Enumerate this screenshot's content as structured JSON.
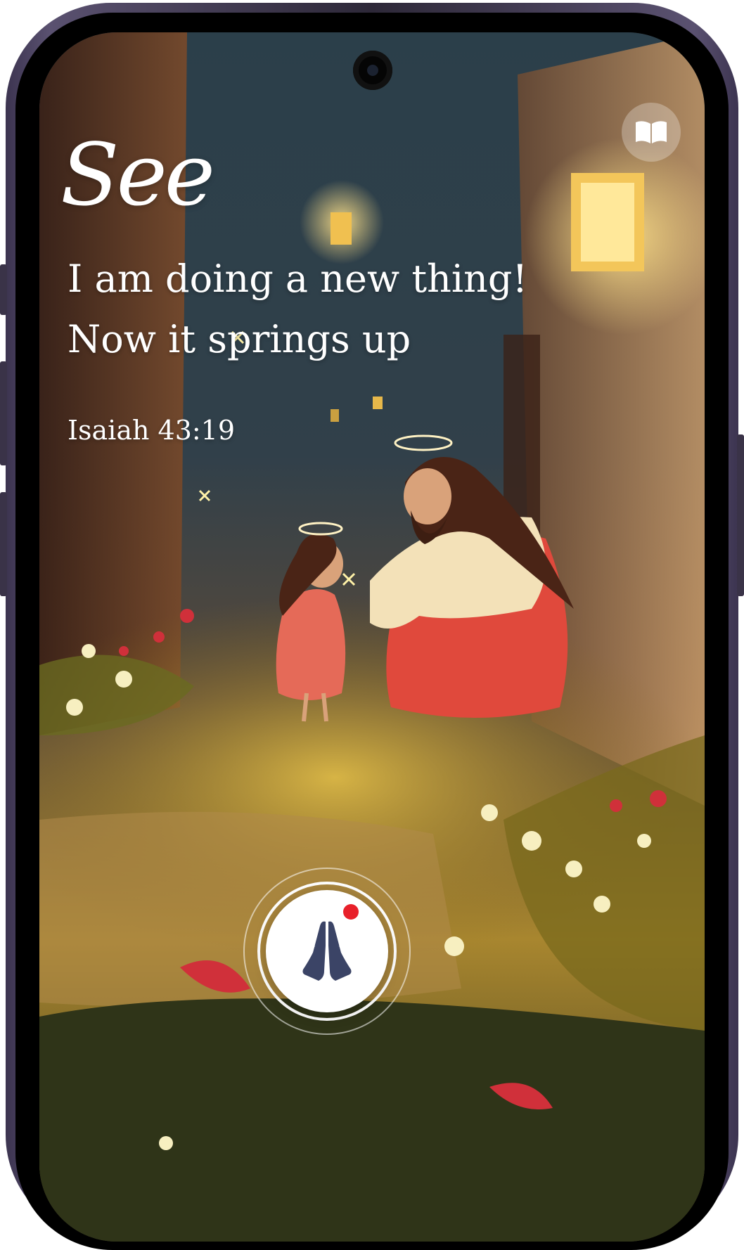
{
  "devotional": {
    "title": "See",
    "verse_lines": [
      "I am doing a new thing!",
      "Now it springs up"
    ],
    "reference": "Isaiah 43:19"
  },
  "buttons": {
    "bible_icon": "open-book-icon",
    "pray_icon": "praying-hands-icon",
    "pray_has_notification": true
  },
  "colors": {
    "accent_red": "#e8202a",
    "hands_navy": "#3b4466",
    "text": "#ffffff"
  }
}
